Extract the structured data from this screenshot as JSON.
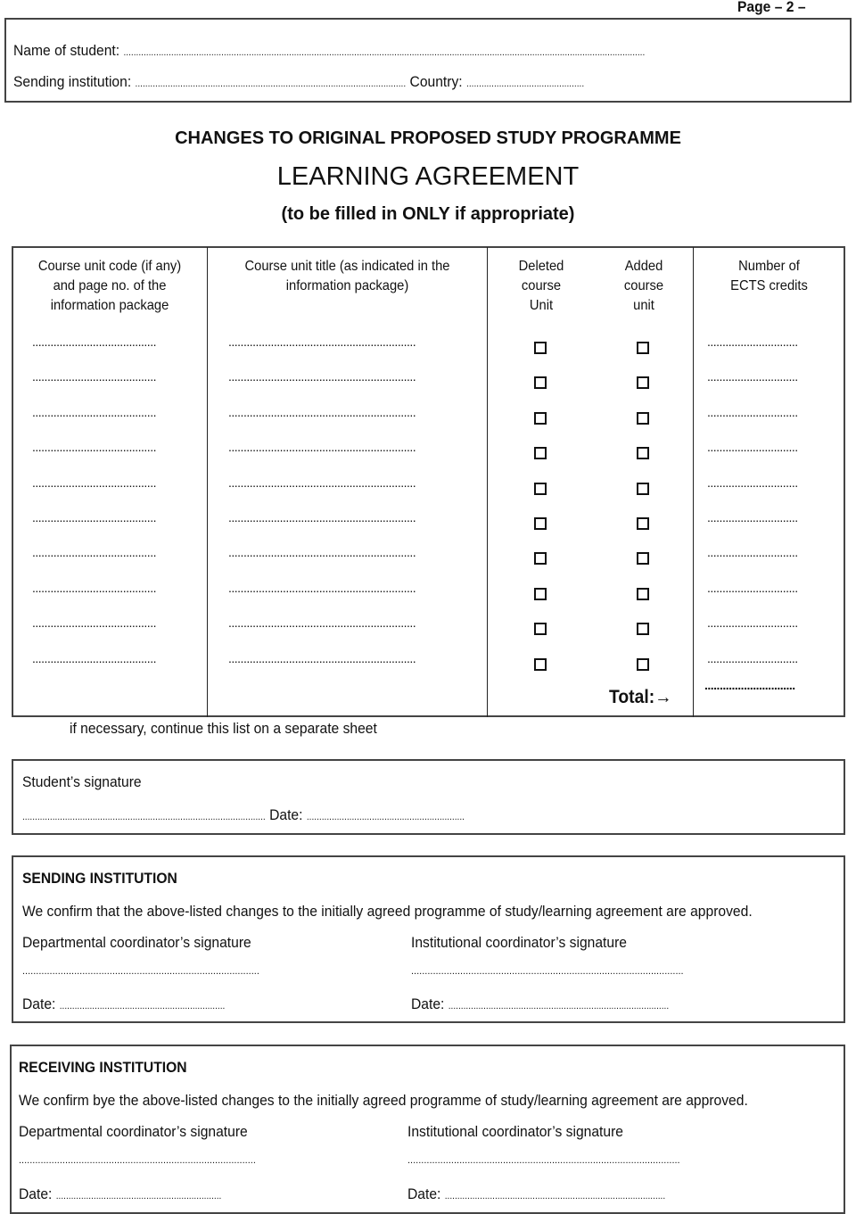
{
  "page_label": "Page – 2 –",
  "student_info": {
    "name_label": "Name of student:",
    "name_value": "................................................................................................................................................................................................................",
    "institution_label": "Sending institution:",
    "institution_value": "............................................................................................................",
    "country_label": "Country:",
    "country_value": "..............................................."
  },
  "titles": {
    "changes": "CHANGES TO ORIGINAL PROPOSED STUDY PROGRAMME",
    "main": "LEARNING AGREEMENT",
    "sub": "(to be filled in ONLY if appropriate)"
  },
  "table": {
    "headers": {
      "code": [
        "Course unit code (if any)",
        "and page no. of the",
        "information package"
      ],
      "title": [
        "Course unit title (as indicated in the",
        "information package)"
      ],
      "deleted": [
        "Deleted",
        "course",
        "Unit"
      ],
      "added": [
        "Added",
        "course",
        "unit"
      ],
      "credits": [
        "Number of",
        "ECTS credits"
      ]
    },
    "row_count": 10,
    "code_placeholder": ".........................................",
    "title_placeholder": "..............................................................",
    "credits_placeholder": "..............................",
    "total_label": "Total:→",
    "total_placeholder": ".............................."
  },
  "note": "if necessary, continue this list on a separate sheet",
  "student_signature": {
    "label": "Student’s signature",
    "sig_value": ".................................................................................................",
    "date_label": "Date:",
    "date_value": "..............................................................."
  },
  "sending": {
    "heading": "SENDING INSTITUTION",
    "statement": "We confirm that the above-listed changes to the initially agreed programme of study/learning agreement are approved.",
    "dept_label": "Departmental coordinator’s signature",
    "inst_label": "Institutional coordinator’s signature",
    "dept_sig": ".......................................................................................",
    "inst_sig": "....................................................................................................",
    "date_label": "Date:",
    "dept_date": "..................................................................",
    "inst_date": "........................................................................................"
  },
  "receiving": {
    "heading": "RECEIVING INSTITUTION",
    "statement": "We confirm bye the above-listed changes to the initially agreed programme of study/learning agreement are approved.",
    "dept_label": "Departmental coordinator’s signature",
    "inst_label": "Institutional coordinator’s signature",
    "dept_sig": ".......................................................................................",
    "inst_sig": "....................................................................................................",
    "date_label": "Date:",
    "dept_date": "..................................................................",
    "inst_date": "........................................................................................"
  }
}
